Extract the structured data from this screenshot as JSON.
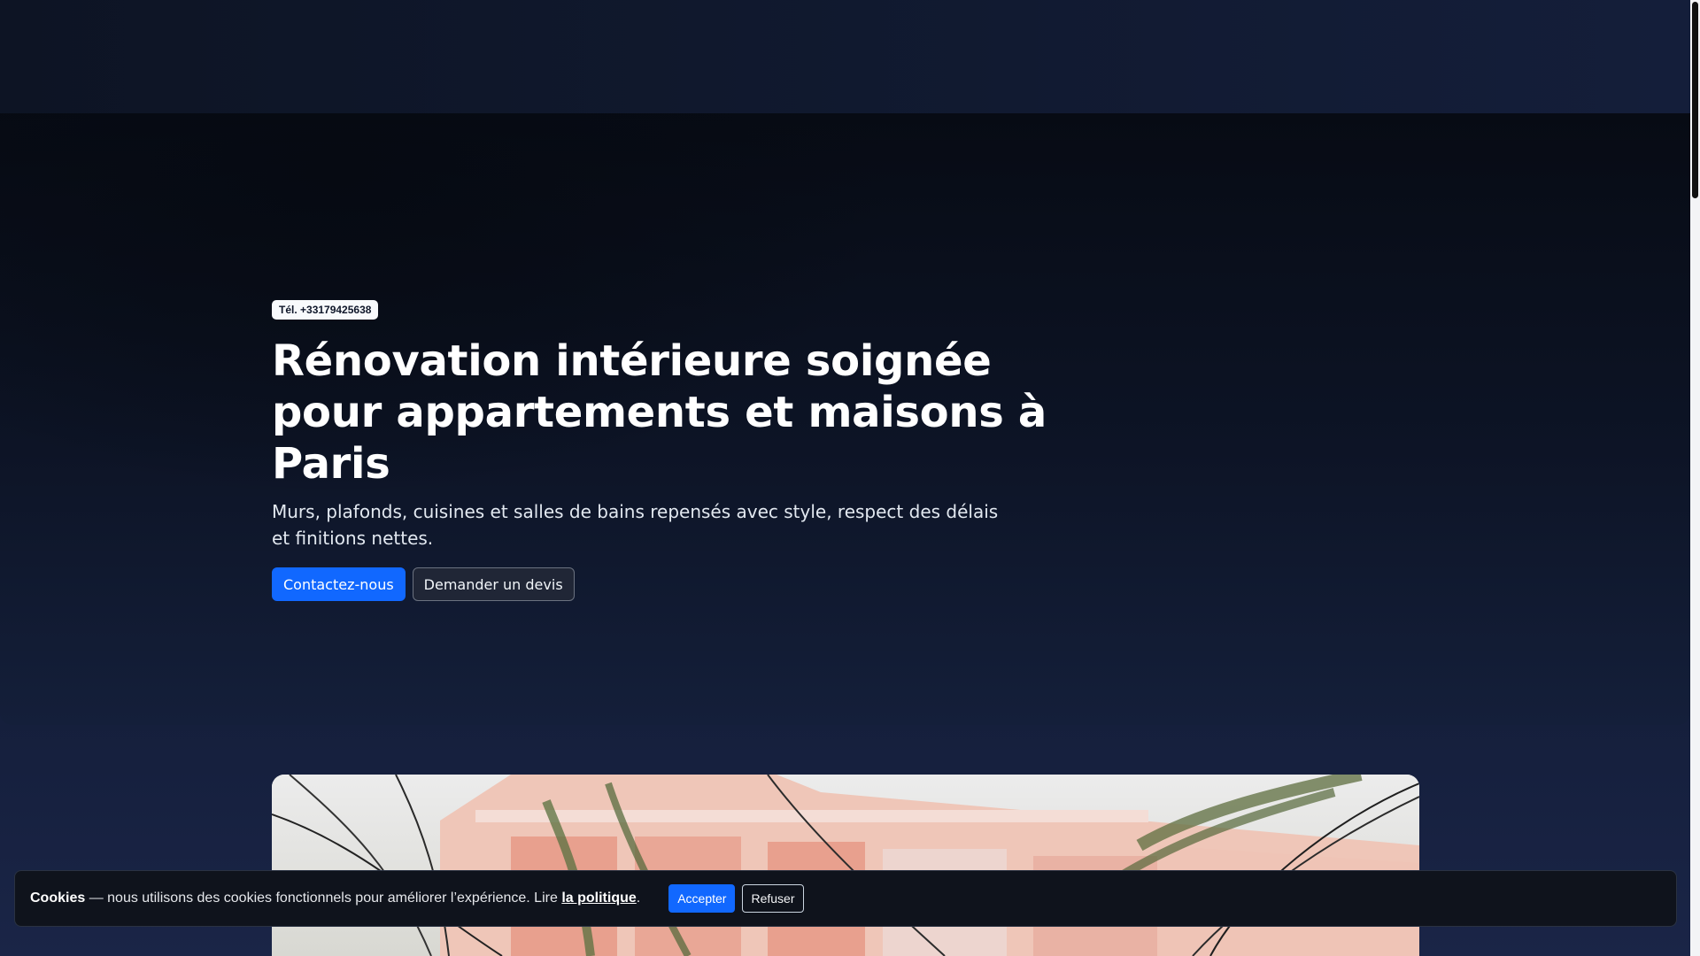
{
  "hero": {
    "phone": "Tél. +33179425638",
    "title": "Rénovation intérieure soignée pour appartements et maisons à Paris",
    "subtitle": "Murs, plafonds, cuisines et salles de bains repensés avec style, respect des délais et finitions nettes.",
    "primary_cta": "Contactez-nous",
    "secondary_cta": "Demander un devis"
  },
  "cookie": {
    "label": "Cookies",
    "text": " — nous utilisons des cookies fonctionnels pour améliorer l’expérience. Lire ",
    "link": "la politique",
    "end": ".",
    "accept": "Accepter",
    "refuse": "Refuser"
  },
  "colors": {
    "accent": "#1168ff",
    "background": "#0f172a"
  }
}
